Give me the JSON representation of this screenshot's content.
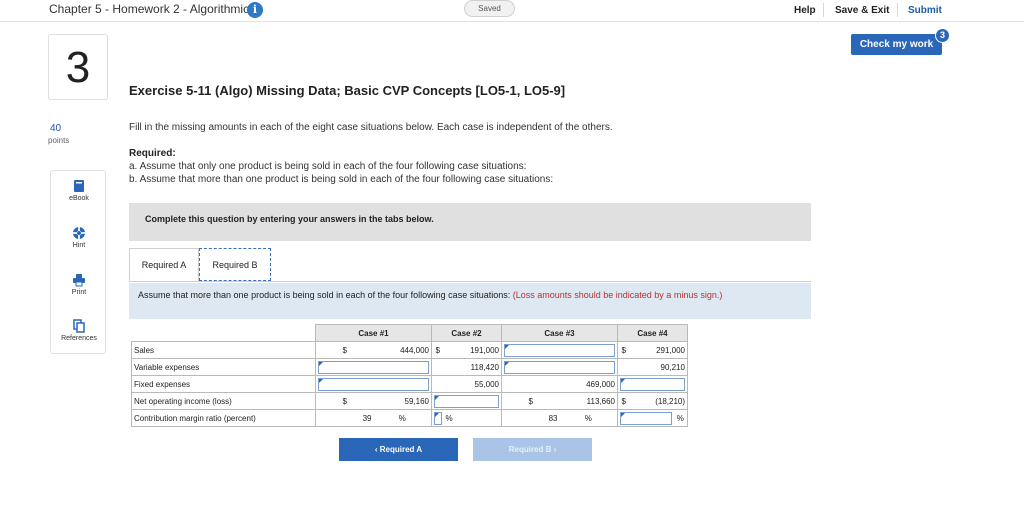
{
  "header": {
    "chapter": "Chapter 5 - Homework 2 - Algorithmic",
    "info_icon": "i",
    "saved": "Saved",
    "help": "Help",
    "save_exit": "Save & Exit",
    "submit": "Submit",
    "check_work": "Check my work",
    "check_badge": "3"
  },
  "question": {
    "number": "3",
    "points_value": "40",
    "points_label": "points"
  },
  "tools": [
    {
      "label": "eBook",
      "icon": "book-icon"
    },
    {
      "label": "Hint",
      "icon": "lifebuoy-icon"
    },
    {
      "label": "Print",
      "icon": "printer-icon"
    },
    {
      "label": "References",
      "icon": "copy-icon"
    }
  ],
  "content": {
    "title": "Exercise 5-11 (Algo) Missing Data; Basic CVP Concepts [LO5-1, LO5-9]",
    "instructions": "Fill in the missing amounts in each of the eight case situations below. Each case is independent of the others.",
    "required_heading": "Required:",
    "required_a": "a. Assume that only one product is being sold in each of the four following case situations:",
    "required_b": "b. Assume that more than one product is being sold in each of the four following case situations:",
    "complete_text": "Complete this question by entering your answers in the tabs below."
  },
  "tabs": {
    "a": "Required A",
    "b": "Required B"
  },
  "assume": {
    "text": "Assume that more than one product is being sold in each of the four following case situations: ",
    "note": "(Loss amounts should be indicated by a minus sign.)"
  },
  "table": {
    "headers": [
      "Case #1",
      "Case #2",
      "Case #3",
      "Case #4"
    ],
    "rows": {
      "sales": {
        "label": "Sales",
        "c1_cur": "$",
        "c1": "444,000",
        "c2_cur": "$",
        "c2": "191,000",
        "c3_cur": "",
        "c3": "",
        "c4_cur": "$",
        "c4": "291,000"
      },
      "variable": {
        "label": "Variable expenses",
        "c1": "",
        "c2": "118,420",
        "c3": "",
        "c4": "90,210"
      },
      "fixed": {
        "label": "Fixed expenses",
        "c1": "",
        "c2": "55,000",
        "c3": "469,000",
        "c4": ""
      },
      "noi": {
        "label": "Net operating income (loss)",
        "c1_cur": "$",
        "c1": "59,160",
        "c2": "",
        "c3_cur": "$",
        "c3": "113,660",
        "c4_cur": "$",
        "c4": "(18,210)"
      },
      "cmr": {
        "label": "Contribution margin ratio (percent)",
        "c1": "39",
        "c2": "",
        "c3": "83",
        "c4": "",
        "pct": "%"
      }
    }
  },
  "nav": {
    "prev": "‹  Required A",
    "next": "Required B  ›"
  }
}
